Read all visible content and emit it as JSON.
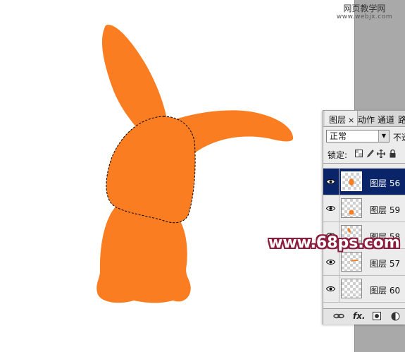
{
  "watermark_top": {
    "line1": "网页教学网",
    "line2": "www.webjx.com"
  },
  "watermark_bottom": "www.68ps.com",
  "colors": {
    "bunny": "#fa7d22",
    "selection": "#0a246a",
    "canvas": "#ffffff",
    "gutter": "#a9a9a9"
  },
  "layers_panel": {
    "tabs": [
      {
        "label": "图层",
        "close": "×",
        "active": true
      },
      {
        "label": "动作",
        "active": false
      },
      {
        "label": "通道",
        "active": false
      },
      {
        "label": "路",
        "active": false
      }
    ],
    "blend_mode": "正常",
    "opacity_label": "不透",
    "lock_label": "锁定:",
    "lock_icons": [
      "lock-transparent-icon",
      "lock-paint-icon",
      "lock-move-icon",
      "lock-all-icon"
    ],
    "layers": [
      {
        "name": "图层 56",
        "selected": true,
        "visible": true
      },
      {
        "name": "图层 59",
        "selected": false,
        "visible": true
      },
      {
        "name": "图层 58",
        "selected": false,
        "visible": true
      },
      {
        "name": "图层 57",
        "selected": false,
        "visible": true
      },
      {
        "name": "图层 60",
        "selected": false,
        "visible": true
      }
    ],
    "footer_icons": [
      "link-icon",
      "fx-icon",
      "mask-icon",
      "adjustment-icon"
    ],
    "footer_fx": "fx."
  }
}
